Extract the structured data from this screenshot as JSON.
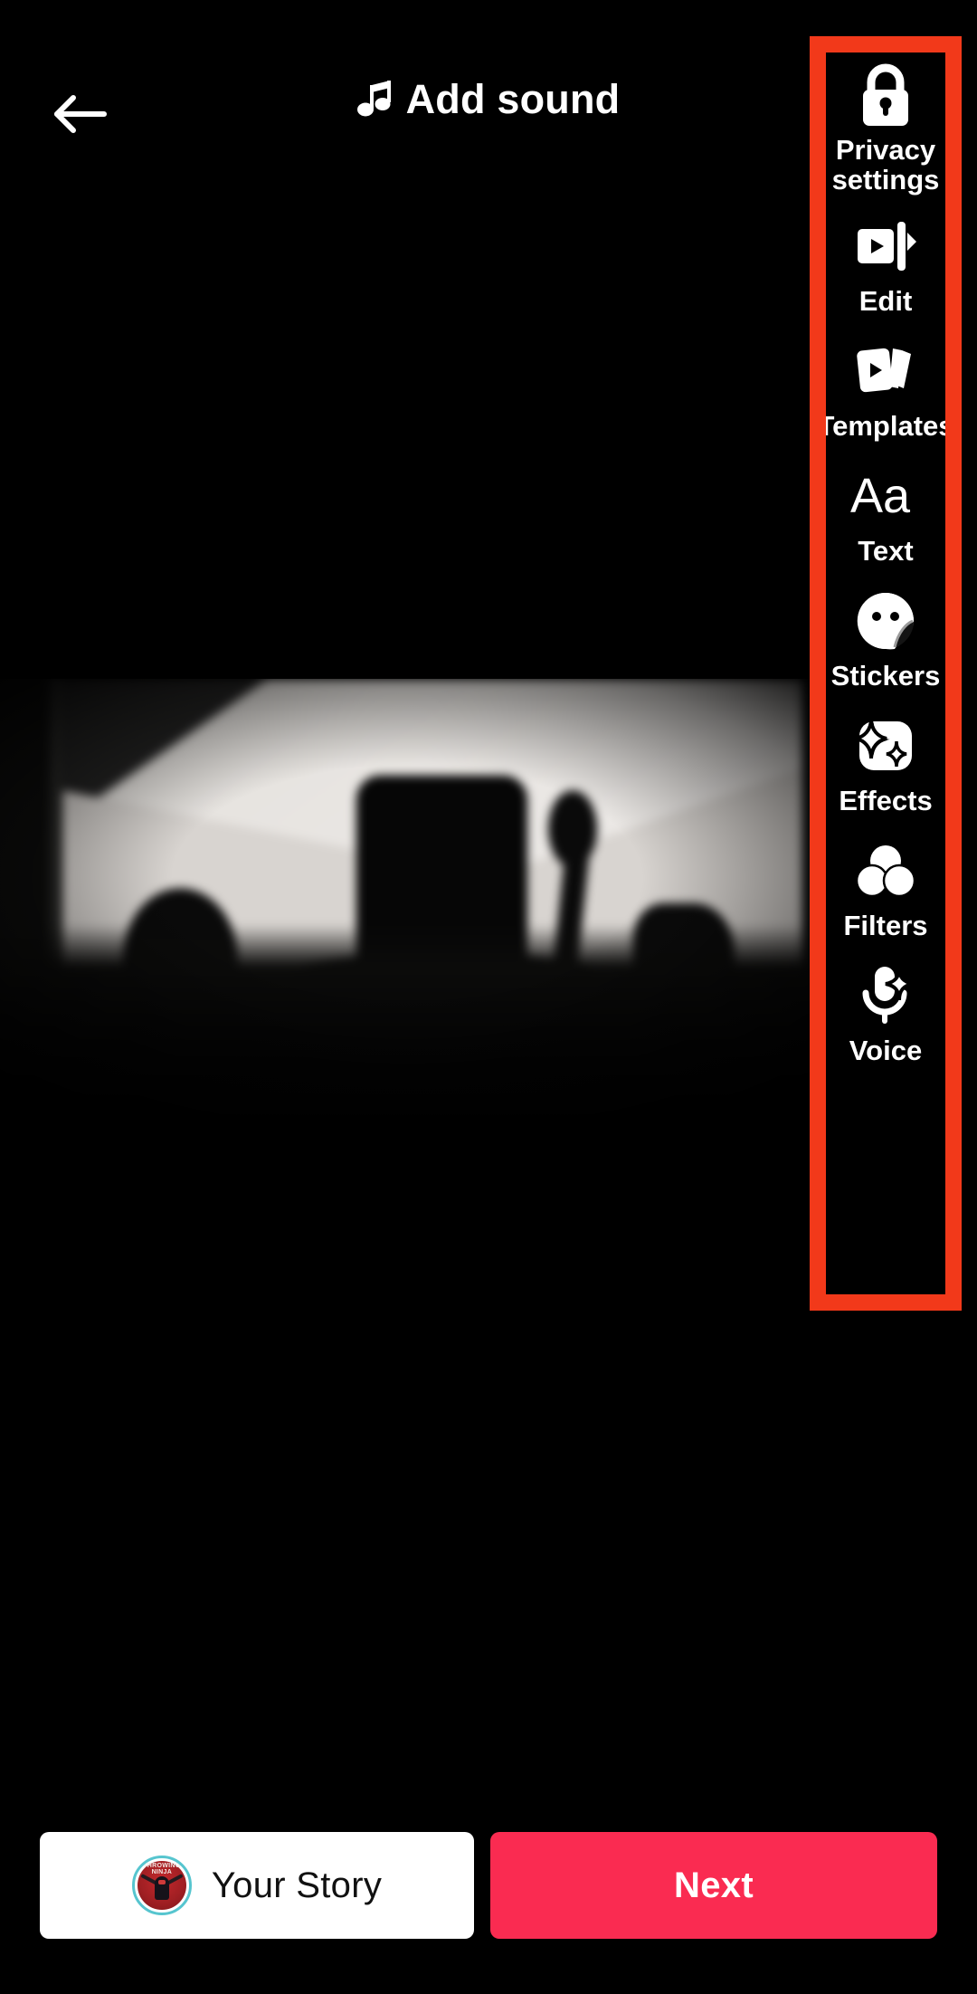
{
  "screen": {
    "app": "video-editor",
    "background_color": "#000000"
  },
  "header": {
    "back_icon": "arrow-left-icon",
    "sound_icon": "music-note-icon",
    "title": "Add sound"
  },
  "preview": {
    "description": "blurred dark video frame with silhouettes of people and a hat"
  },
  "toolbar": {
    "highlight_color": "#f2391a",
    "items": [
      {
        "label": "Privacy settings",
        "icon": "lock-icon",
        "two_line": true
      },
      {
        "label": "Edit",
        "icon": "video-trim-icon",
        "two_line": false
      },
      {
        "label": "Templates",
        "icon": "template-cards-icon",
        "two_line": false
      },
      {
        "label": "Text",
        "icon": "text-aa-icon",
        "two_line": false
      },
      {
        "label": "Stickers",
        "icon": "sticker-smiley-icon",
        "two_line": false
      },
      {
        "label": "Effects",
        "icon": "effects-sparkle-icon",
        "two_line": false
      },
      {
        "label": "Filters",
        "icon": "filters-circles-icon",
        "two_line": false
      },
      {
        "label": "Voice",
        "icon": "microphone-sparkle-icon",
        "two_line": false
      }
    ]
  },
  "bottom_bar": {
    "story_label": "Your Story",
    "story_avatar": "user-avatar",
    "avatar_arc_text": "THROWING NINJA",
    "next_label": "Next",
    "next_color": "#fa2b51"
  }
}
